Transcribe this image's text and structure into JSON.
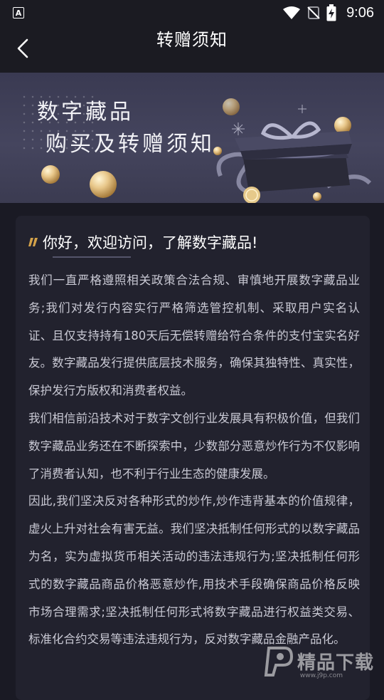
{
  "status_bar": {
    "app_badge": "A",
    "time": "9:06"
  },
  "header": {
    "title": "转赠须知"
  },
  "banner": {
    "line1": "数字藏品",
    "line2": "购买及转赠须知"
  },
  "card": {
    "heading": "你好，欢迎访问，了解数字藏品!",
    "paragraphs": [
      "我们一直严格遵照相关政策合法合规、审慎地开展数字藏品业务;我们对发行内容实行严格筛选管控机制、采取用户实名认证、且仅支持持有180天后无偿转赠给符合条件的支付宝实名好友。数字藏品发行提供底层技术服务，确保其独特性、真实性，保护发行方版权和消费者权益。",
      "我们相信前沿技术对于数字文创行业发展具有积极价值，但我们数字藏品业务还在不断探索中，少数部分恶意炒作行为不仅影响了消费者认知，也不利于行业生态的健康发展。",
      "因此,我们坚决反对各种形式的炒作,炒作违背基本的价值规律，虚火上升对社会有害无益。我们坚决抵制任何形式的以数字藏品为名，实为虚拟货币相关活动的违法违规行为;坚决抵制任何形式的数字藏品商品价格恶意炒作,用技术手段确保商品价格反映市场合理需求;坚决抵制任何形式将数字藏品进行权益类交易、标准化合约交易等违法违规行为，反对数字藏品金融产品化。"
    ]
  },
  "watermark": {
    "brand": "精品下载",
    "url": "www.j9p.com"
  },
  "icons": {
    "back": "chevron-left-icon",
    "wifi": "wifi-icon",
    "signal": "no-signal-icon",
    "battery": "battery-charging-icon",
    "quote": "quote-mark-icon"
  },
  "colors": {
    "background": "#1a1a24",
    "card": "#22222e",
    "body_text": "#c9c9d4",
    "accent_gold": "#d4a24a"
  }
}
